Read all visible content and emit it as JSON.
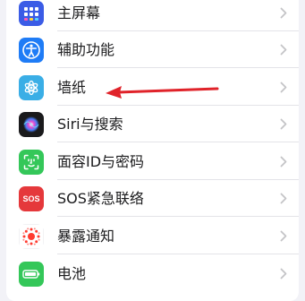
{
  "settings": {
    "items": [
      {
        "label": "主屏幕",
        "icon": "home-screen-grid-icon",
        "color": "#3b5ce6"
      },
      {
        "label": "辅助功能",
        "icon": "accessibility-person-icon",
        "color": "#1f7cf6"
      },
      {
        "label": "墙纸",
        "icon": "wallpaper-flower-icon",
        "color": "#3aaee6"
      },
      {
        "label": "Siri与搜索",
        "icon": "siri-orb-icon",
        "color": "#1a1a1c"
      },
      {
        "label": "面容ID与密码",
        "icon": "face-id-icon",
        "color": "#34c759"
      },
      {
        "label": "SOS紧急联络",
        "icon": "sos-icon",
        "color": "#e5383b",
        "badge": "SOS"
      },
      {
        "label": "暴露通知",
        "icon": "exposure-notification-icon",
        "color": "#ff3b30"
      },
      {
        "label": "电池",
        "icon": "battery-icon",
        "color": "#34c759"
      }
    ]
  },
  "annotation": {
    "color": "#e0232a",
    "points_to": "墙纸"
  }
}
